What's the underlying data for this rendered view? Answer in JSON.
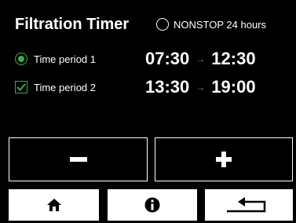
{
  "header": {
    "title": "Filtration Timer",
    "nonstop_label": "NONSTOP 24 hours",
    "nonstop_selected": false
  },
  "periods": [
    {
      "label": "Time period 1",
      "control": "radio",
      "selected": true,
      "start": "07:30",
      "end": "12:30"
    },
    {
      "label": "Time period 2",
      "control": "checkbox",
      "checked": true,
      "start": "13:30",
      "end": "19:00"
    }
  ],
  "arrow_glyph": "→",
  "buttons": {
    "minus": {
      "icon": "minus-icon"
    },
    "plus": {
      "icon": "plus-icon"
    }
  },
  "nav": {
    "home": {
      "icon": "home-icon"
    },
    "info": {
      "icon": "info-icon"
    },
    "back": {
      "icon": "return-arrow-icon"
    }
  },
  "colors": {
    "background": "#000000",
    "foreground": "#ffffff",
    "accent": "#2db24a"
  }
}
